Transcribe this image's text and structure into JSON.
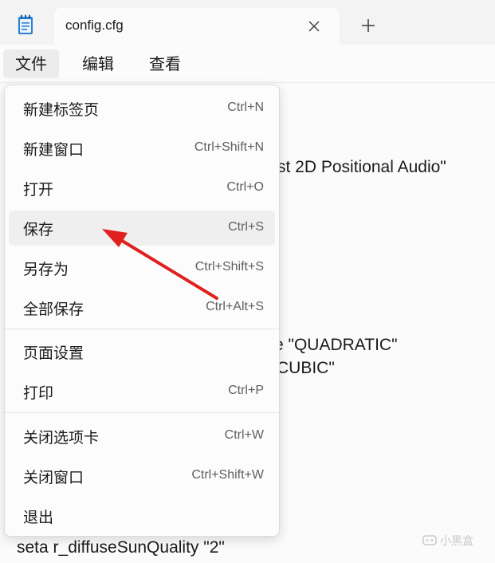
{
  "tab": {
    "title": "config.cfg"
  },
  "menubar": {
    "file": "文件",
    "edit": "编辑",
    "view": "查看"
  },
  "file_menu": {
    "items": [
      {
        "label": "新建标签页",
        "shortcut": "Ctrl+N"
      },
      {
        "label": "新建窗口",
        "shortcut": "Ctrl+Shift+N"
      },
      {
        "label": "打开",
        "shortcut": "Ctrl+O"
      },
      {
        "label": "保存",
        "shortcut": "Ctrl+S"
      },
      {
        "label": "另存为",
        "shortcut": "Ctrl+Shift+S"
      },
      {
        "label": "全部保存",
        "shortcut": "Ctrl+Alt+S"
      },
      {
        "label": "页面设置",
        "shortcut": ""
      },
      {
        "label": "打印",
        "shortcut": "Ctrl+P"
      },
      {
        "label": "关闭选项卡",
        "shortcut": "Ctrl+W"
      },
      {
        "label": "关闭窗口",
        "shortcut": "Ctrl+Shift+W"
      },
      {
        "label": "退出",
        "shortcut": ""
      }
    ],
    "hovered_item": "保存"
  },
  "editor": {
    "visible_fragments": [
      "st 2D Positional Audio\"",
      "e \"QUADRATIC\"",
      "CUBIC\"",
      "seta r_diffuseSunQuality \"2\"",
      "",
      ""
    ]
  },
  "watermark": {
    "text": "小黑盒"
  },
  "colors": {
    "arrow": "#e0201e",
    "menu_hover": "#efefef",
    "background": "#f9f9f9"
  }
}
